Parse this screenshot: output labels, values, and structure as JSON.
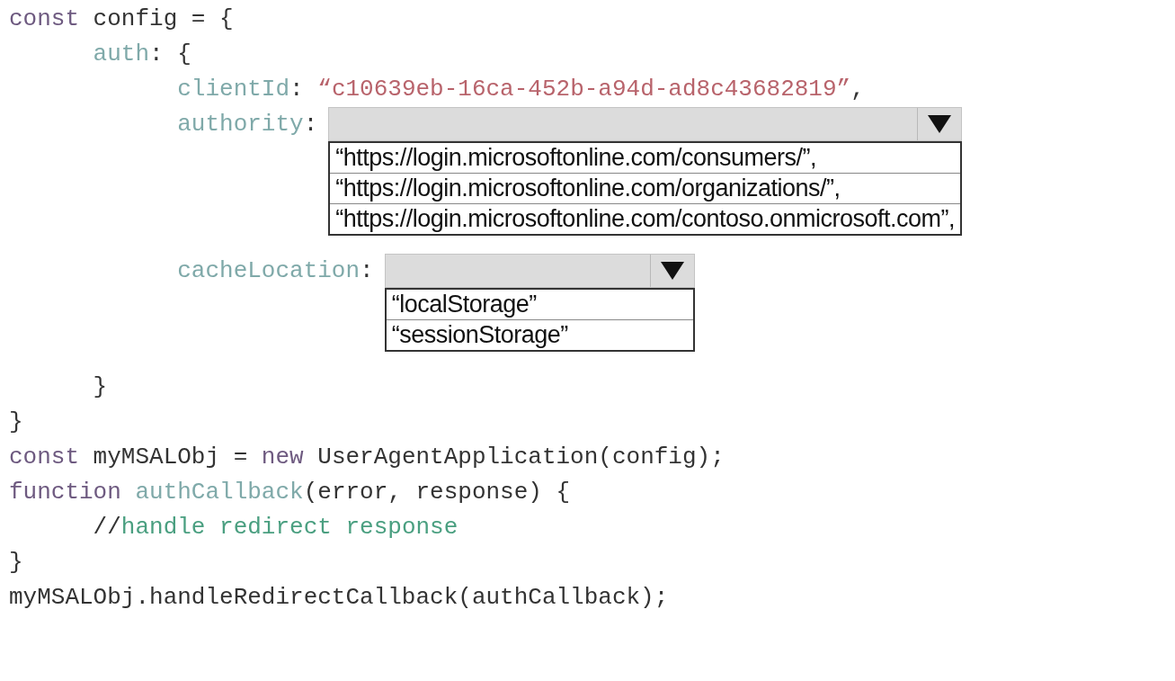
{
  "code_lines": [
    {
      "tokens": [
        {
          "kind": "keyword",
          "text": "const"
        },
        {
          "kind": "plain",
          "text": " config = {"
        }
      ]
    },
    {
      "tokens": [
        {
          "kind": "property",
          "text": "      auth"
        },
        {
          "kind": "plain",
          "text": ": {"
        }
      ]
    },
    {
      "tokens": [
        {
          "kind": "property",
          "text": "            clientId"
        },
        {
          "kind": "plain",
          "text": ": "
        },
        {
          "kind": "string",
          "text": "“c10639eb-16ca-452b-a94d-ad8c43682819”"
        },
        {
          "kind": "plain",
          "text": ","
        }
      ]
    },
    {
      "tokens": [
        {
          "kind": "property",
          "text": "            authority"
        },
        {
          "kind": "plain",
          "text": ":"
        }
      ],
      "dropdown": {
        "options": [
          "“https://login.microsoftonline.com/consumers/”,",
          "“https://login.microsoftonline.com/organizations/”,",
          "“https://login.microsoftonline.com/contoso.onmicrosoft.com”,"
        ]
      }
    },
    {
      "tokens": [
        {
          "kind": "property",
          "text": "            cacheLocation"
        },
        {
          "kind": "plain",
          "text": ":"
        }
      ],
      "dropdown": {
        "options": [
          "“localStorage”",
          "“sessionStorage”"
        ]
      }
    },
    {
      "tokens": [
        {
          "kind": "plain",
          "text": "      }"
        }
      ]
    },
    {
      "tokens": [
        {
          "kind": "plain",
          "text": "}"
        }
      ]
    },
    {
      "tokens": [
        {
          "kind": "keyword",
          "text": "const"
        },
        {
          "kind": "plain",
          "text": " myMSALObj = "
        },
        {
          "kind": "keyword",
          "text": "new"
        },
        {
          "kind": "plain",
          "text": " UserAgentApplication(config);"
        }
      ]
    },
    {
      "tokens": [
        {
          "kind": "keyword",
          "text": "function "
        },
        {
          "kind": "function",
          "text": "authCallback"
        },
        {
          "kind": "plain",
          "text": "(error, response) {"
        }
      ]
    },
    {
      "tokens": [
        {
          "kind": "plain",
          "text": "      //"
        },
        {
          "kind": "comment",
          "text": "handle redirect response"
        }
      ]
    },
    {
      "tokens": [
        {
          "kind": "plain",
          "text": "}"
        }
      ]
    },
    {
      "tokens": [
        {
          "kind": "plain",
          "text": "myMSALObj.handleRedirectCallback(authCallback);"
        }
      ]
    }
  ]
}
